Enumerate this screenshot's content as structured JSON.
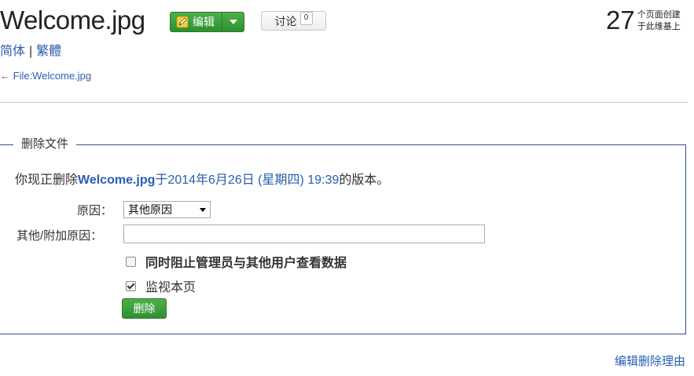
{
  "page": {
    "title": "Welcome.jpg",
    "edit_label": "编辑",
    "talk_label": "讨论",
    "talk_count": "0",
    "counter_number": "27",
    "counter_line1": "个页面创建",
    "counter_line2": "于此维基上"
  },
  "variants": {
    "simplified": "简体",
    "separator": "|",
    "traditional": "繁體"
  },
  "back_link": {
    "arrow": "←",
    "text": "File:Welcome.jpg"
  },
  "form": {
    "legend": "删除文件",
    "intro_prefix": "你现正删除",
    "intro_file": "Welcome.jpg",
    "intro_mid": "于",
    "intro_date": "2014年6月26日 (星期四) 19:39",
    "intro_suffix": "的版本。",
    "reason_label": "原因：",
    "reason_selected": "其他原因",
    "other_label": "其他/附加原因：",
    "other_value": "",
    "suppress_label": "同时阻止管理员与其他用户查看数据",
    "suppress_checked": false,
    "watch_label": "监视本页",
    "watch_checked": true,
    "delete_button": "删除"
  },
  "footer": {
    "edit_reasons_link": "编辑删除理由"
  },
  "colors": {
    "accent_green": "#3a9d3a",
    "link_blue": "#2a5db0",
    "border_blue": "#2f4f8f"
  }
}
